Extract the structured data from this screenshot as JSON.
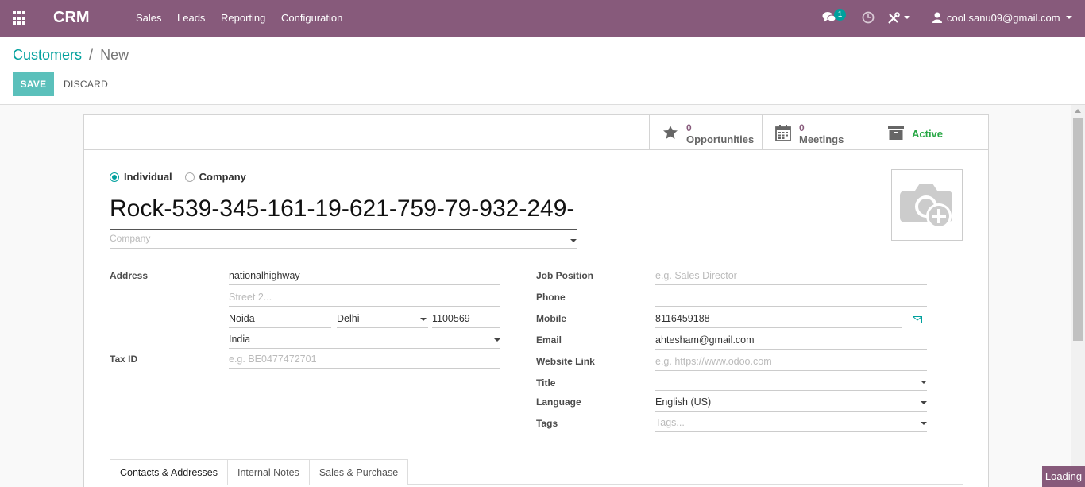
{
  "navbar": {
    "brand": "CRM",
    "menu": [
      "Sales",
      "Leads",
      "Reporting",
      "Configuration"
    ],
    "chat_count": "1",
    "user": "cool.sanu09@gmail.com"
  },
  "breadcrumb": {
    "parent": "Customers",
    "separator": "/",
    "current": "New"
  },
  "actions": {
    "save": "SAVE",
    "discard": "DISCARD"
  },
  "stat_buttons": {
    "opportunities": {
      "count": "0",
      "label": "Opportunities"
    },
    "meetings": {
      "count": "0",
      "label": "Meetings"
    },
    "active": {
      "label": "Active"
    }
  },
  "type_options": {
    "individual": "Individual",
    "company": "Company",
    "selected": "individual"
  },
  "record": {
    "name": "Rock-539-345-161-19-621-759-79-932-249-",
    "company_placeholder": "Company"
  },
  "left_fields": {
    "address_label": "Address",
    "street": "nationalhighway",
    "street2_placeholder": "Street 2...",
    "city": "Noida",
    "state": "Delhi",
    "zip": "1100569",
    "country": "India",
    "tax_label": "Tax ID",
    "tax_placeholder": "e.g. BE0477472701"
  },
  "right_fields": {
    "job_label": "Job Position",
    "job_placeholder": "e.g. Sales Director",
    "phone_label": "Phone",
    "phone": "",
    "mobile_label": "Mobile",
    "mobile": "8116459188",
    "email_label": "Email",
    "email": "ahtesham@gmail.com",
    "website_label": "Website Link",
    "website_placeholder": "e.g. https://www.odoo.com",
    "title_label": "Title",
    "title": "",
    "language_label": "Language",
    "language": "English (US)",
    "tags_label": "Tags",
    "tags_placeholder": "Tags..."
  },
  "tabs": [
    "Contacts & Addresses",
    "Internal Notes",
    "Sales & Purchase"
  ],
  "status": {
    "loading": "Loading"
  },
  "colors": {
    "brand": "#875a7b",
    "accent": "#00a09d",
    "save": "#5bc0bb",
    "active": "#28a745"
  }
}
